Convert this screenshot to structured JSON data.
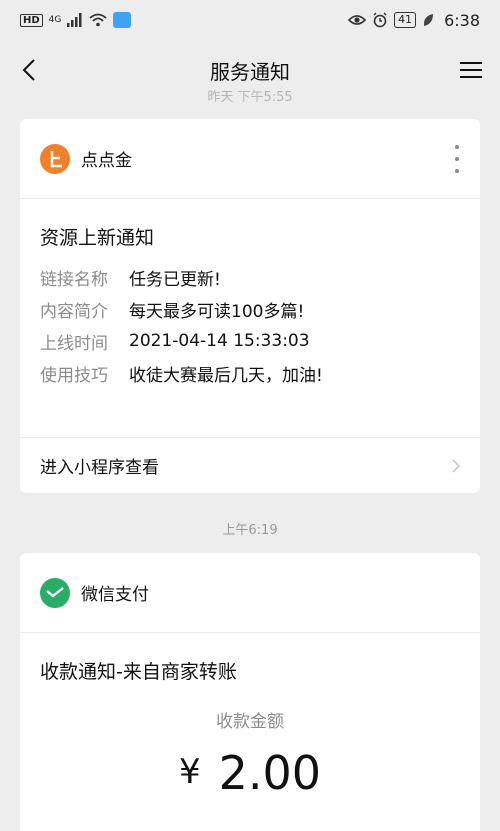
{
  "status_bar": {
    "hd": "HD",
    "net": "4G",
    "battery": "41",
    "time": "6:38"
  },
  "nav": {
    "title": "服务通知"
  },
  "top_timestamp": "昨天 下午5:55",
  "card1": {
    "brand": "点点金",
    "notice_title": "资源上新通知",
    "fields": [
      {
        "label": "链接名称",
        "value": "任务已更新!"
      },
      {
        "label": "内容简介",
        "value": "每天最多可读100多篇!"
      },
      {
        "label": "上线时间",
        "value": "2021-04-14 15:33:03"
      },
      {
        "label": "使用技巧",
        "value": "收徒大赛最后几天，加油!"
      }
    ],
    "footer": "进入小程序查看"
  },
  "mid_timestamp": "上午6:19",
  "card2": {
    "brand": "微信支付",
    "notice_title": "收款通知-来自商家转账",
    "amount_label": "收款金额",
    "currency": "¥",
    "amount": "2.00"
  },
  "colors": {
    "background": "#ededed",
    "dd_brand": "#f0812c",
    "wechat_pay": "#2aae67"
  }
}
